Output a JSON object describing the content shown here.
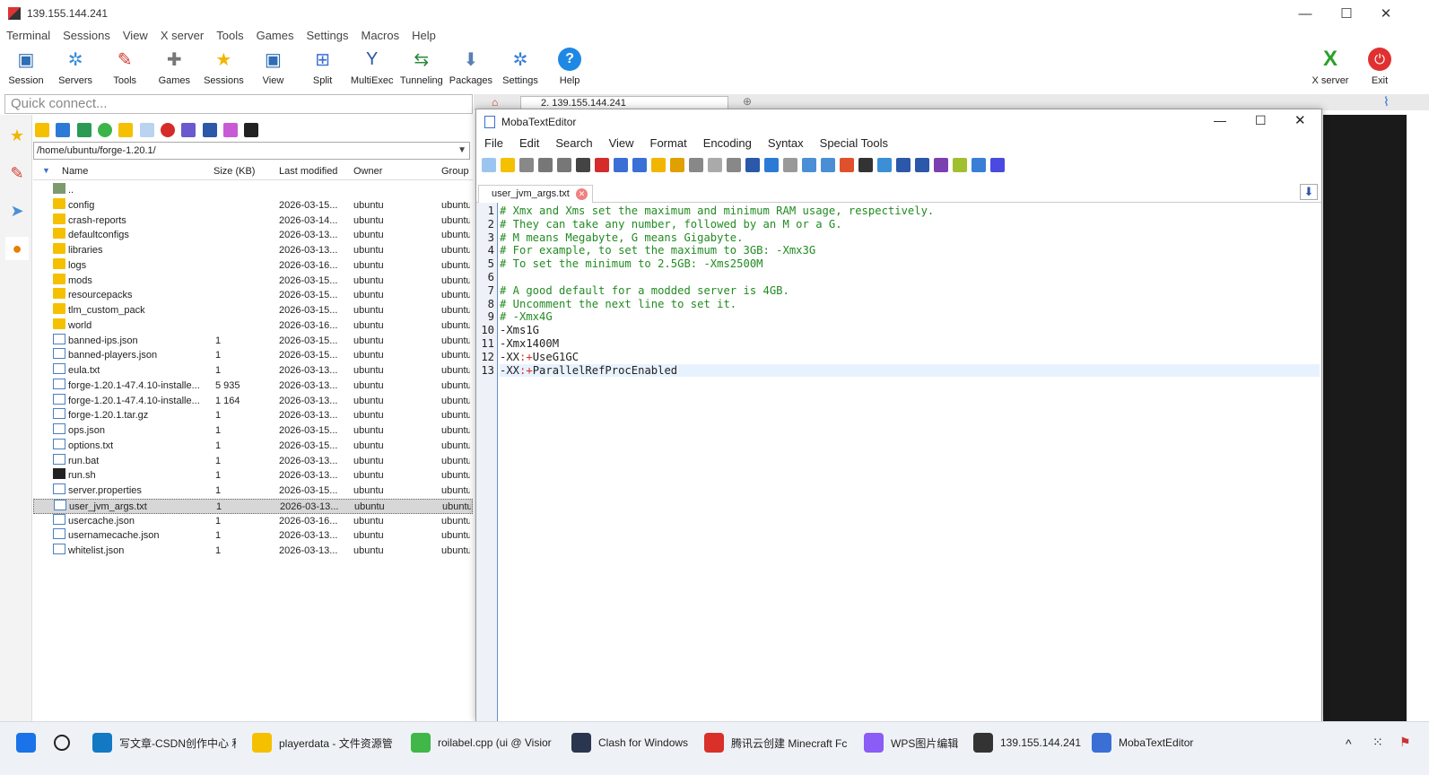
{
  "window": {
    "title": "139.155.144.241"
  },
  "menu": [
    "Terminal",
    "Sessions",
    "View",
    "X server",
    "Tools",
    "Games",
    "Settings",
    "Macros",
    "Help"
  ],
  "toolbar": [
    {
      "label": "Session",
      "icon": "monitor-icon",
      "color": "#2f6db5"
    },
    {
      "label": "Servers",
      "icon": "servers-icon",
      "color": "#3a8fd6"
    },
    {
      "label": "Tools",
      "icon": "tools-icon",
      "color": "#d43a2f"
    },
    {
      "label": "Games",
      "icon": "gamepad-icon",
      "color": "#777777"
    },
    {
      "label": "Sessions",
      "icon": "star-icon",
      "color": "#f2b600"
    },
    {
      "label": "View",
      "icon": "view-icon",
      "color": "#2f6db5"
    },
    {
      "label": "Split",
      "icon": "split-icon",
      "color": "#3a6fd6"
    },
    {
      "label": "MultiExec",
      "icon": "fork-icon",
      "color": "#2b58a8"
    },
    {
      "label": "Tunneling",
      "icon": "tunnel-icon",
      "color": "#2a8a3a"
    },
    {
      "label": "Packages",
      "icon": "package-icon",
      "color": "#5a7fb5"
    },
    {
      "label": "Settings",
      "icon": "gear-icon",
      "color": "#3a7fd6"
    },
    {
      "label": "Help",
      "icon": "help-icon",
      "color": "#1e88e5"
    }
  ],
  "toolbar_right": [
    {
      "label": "X server",
      "icon": "x-server-icon"
    },
    {
      "label": "Exit",
      "icon": "power-icon"
    }
  ],
  "quick_connect": {
    "placeholder": "Quick connect..."
  },
  "session_tab": {
    "label": "2. 139.155.144.241"
  },
  "sftp": {
    "path": "/home/ubuntu/forge-1.20.1/",
    "columns": [
      "Name",
      "Size (KB)",
      "Last modified",
      "Owner",
      "Group"
    ],
    "files": [
      {
        "name": "..",
        "size": "",
        "modified": "",
        "owner": "",
        "group": "",
        "type": "up"
      },
      {
        "name": "config",
        "size": "",
        "modified": "2026-03-15...",
        "owner": "ubuntu",
        "group": "ubuntu",
        "type": "folder"
      },
      {
        "name": "crash-reports",
        "size": "",
        "modified": "2026-03-14...",
        "owner": "ubuntu",
        "group": "ubuntu",
        "type": "folder"
      },
      {
        "name": "defaultconfigs",
        "size": "",
        "modified": "2026-03-13...",
        "owner": "ubuntu",
        "group": "ubuntu",
        "type": "folder"
      },
      {
        "name": "libraries",
        "size": "",
        "modified": "2026-03-13...",
        "owner": "ubuntu",
        "group": "ubuntu",
        "type": "folder"
      },
      {
        "name": "logs",
        "size": "",
        "modified": "2026-03-16...",
        "owner": "ubuntu",
        "group": "ubuntu",
        "type": "folder"
      },
      {
        "name": "mods",
        "size": "",
        "modified": "2026-03-15...",
        "owner": "ubuntu",
        "group": "ubuntu",
        "type": "folder"
      },
      {
        "name": "resourcepacks",
        "size": "",
        "modified": "2026-03-15...",
        "owner": "ubuntu",
        "group": "ubuntu",
        "type": "folder"
      },
      {
        "name": "tlm_custom_pack",
        "size": "",
        "modified": "2026-03-15...",
        "owner": "ubuntu",
        "group": "ubuntu",
        "type": "folder"
      },
      {
        "name": "world",
        "size": "",
        "modified": "2026-03-16...",
        "owner": "ubuntu",
        "group": "ubuntu",
        "type": "folder"
      },
      {
        "name": "banned-ips.json",
        "size": "1",
        "modified": "2026-03-15...",
        "owner": "ubuntu",
        "group": "ubuntu",
        "type": "doc"
      },
      {
        "name": "banned-players.json",
        "size": "1",
        "modified": "2026-03-15...",
        "owner": "ubuntu",
        "group": "ubuntu",
        "type": "doc"
      },
      {
        "name": "eula.txt",
        "size": "1",
        "modified": "2026-03-13...",
        "owner": "ubuntu",
        "group": "ubuntu",
        "type": "doc"
      },
      {
        "name": "forge-1.20.1-47.4.10-installe...",
        "size": "5 935",
        "modified": "2026-03-13...",
        "owner": "ubuntu",
        "group": "ubuntu",
        "type": "doc"
      },
      {
        "name": "forge-1.20.1-47.4.10-installe...",
        "size": "1 164",
        "modified": "2026-03-13...",
        "owner": "ubuntu",
        "group": "ubuntu",
        "type": "doc"
      },
      {
        "name": "forge-1.20.1.tar.gz",
        "size": "1",
        "modified": "2026-03-13...",
        "owner": "ubuntu",
        "group": "ubuntu",
        "type": "doc"
      },
      {
        "name": "ops.json",
        "size": "1",
        "modified": "2026-03-15...",
        "owner": "ubuntu",
        "group": "ubuntu",
        "type": "doc"
      },
      {
        "name": "options.txt",
        "size": "1",
        "modified": "2026-03-15...",
        "owner": "ubuntu",
        "group": "ubuntu",
        "type": "doc"
      },
      {
        "name": "run.bat",
        "size": "1",
        "modified": "2026-03-13...",
        "owner": "ubuntu",
        "group": "ubuntu",
        "type": "doc"
      },
      {
        "name": "run.sh",
        "size": "1",
        "modified": "2026-03-13...",
        "owner": "ubuntu",
        "group": "ubuntu",
        "type": "term"
      },
      {
        "name": "server.properties",
        "size": "1",
        "modified": "2026-03-15...",
        "owner": "ubuntu",
        "group": "ubuntu",
        "type": "doc"
      },
      {
        "name": "user_jvm_args.txt",
        "size": "1",
        "modified": "2026-03-13...",
        "owner": "ubuntu",
        "group": "ubuntu",
        "type": "doc",
        "selected": true
      },
      {
        "name": "usercache.json",
        "size": "1",
        "modified": "2026-03-16...",
        "owner": "ubuntu",
        "group": "ubuntu",
        "type": "doc"
      },
      {
        "name": "usernamecache.json",
        "size": "1",
        "modified": "2026-03-13...",
        "owner": "ubuntu",
        "group": "ubuntu",
        "type": "doc"
      },
      {
        "name": "whitelist.json",
        "size": "1",
        "modified": "2026-03-13...",
        "owner": "ubuntu",
        "group": "ubuntu",
        "type": "doc"
      }
    ]
  },
  "editor": {
    "title": "MobaTextEditor",
    "menu": [
      "File",
      "Edit",
      "Search",
      "View",
      "Format",
      "Encoding",
      "Syntax",
      "Special Tools"
    ],
    "tab": "user_jvm_args.txt",
    "lines": [
      {
        "n": "1",
        "text": "# Xmx and Xms set the maximum and minimum RAM usage, respectively.",
        "kind": "comment"
      },
      {
        "n": "2",
        "text": "# They can take any number, followed by an M or a G.",
        "kind": "comment"
      },
      {
        "n": "3",
        "text": "# M means Megabyte, G means Gigabyte.",
        "kind": "comment"
      },
      {
        "n": "4",
        "text": "# For example, to set the maximum to 3GB: -Xmx3G",
        "kind": "comment"
      },
      {
        "n": "5",
        "text": "# To set the minimum to 2.5GB: -Xms2500M",
        "kind": "comment"
      },
      {
        "n": "6",
        "text": "",
        "kind": "plain"
      },
      {
        "n": "7",
        "text": "# A good default for a modded server is 4GB.",
        "kind": "comment"
      },
      {
        "n": "8",
        "text": "# Uncomment the next line to set it.",
        "kind": "comment"
      },
      {
        "n": "9",
        "text": "# -Xmx4G",
        "kind": "comment"
      },
      {
        "n": "10",
        "text": "-Xms1G",
        "kind": "plain"
      },
      {
        "n": "11",
        "text": "-Xmx1400M",
        "kind": "plain"
      },
      {
        "n": "12",
        "text": "-XX:+UseG1GC",
        "kind": "opt"
      },
      {
        "n": "13",
        "text": "-XX:+ParallelRefProcEnabled",
        "kind": "opt"
      }
    ]
  },
  "taskbar": [
    {
      "label": "",
      "icon": "windows-start-icon",
      "color": "#1a73e8"
    },
    {
      "label": "",
      "icon": "search-icon",
      "color": "#222222"
    },
    {
      "label": "写文章-CSDN创作中心 和",
      "icon": "edge-icon",
      "color": "#1479c4"
    },
    {
      "label": "playerdata - 文件资源管",
      "icon": "folder-icon",
      "color": "#f5c000"
    },
    {
      "label": "roilabel.cpp (ui @ Visior",
      "icon": "qt-icon",
      "color": "#41b649"
    },
    {
      "label": "Clash for Windows",
      "icon": "cat-icon",
      "color": "#2a3550"
    },
    {
      "label": "腾讯云创建 Minecraft Fc",
      "icon": "wps-icon",
      "color": "#d9302a"
    },
    {
      "label": "WPS图片编辑",
      "icon": "wps-image-icon",
      "color": "#8b5cf6"
    },
    {
      "label": "139.155.144.241",
      "icon": "mobaxterm-icon",
      "color": "#333333"
    },
    {
      "label": "MobaTextEditor",
      "icon": "editor-icon",
      "color": "#3a6fd6"
    }
  ]
}
